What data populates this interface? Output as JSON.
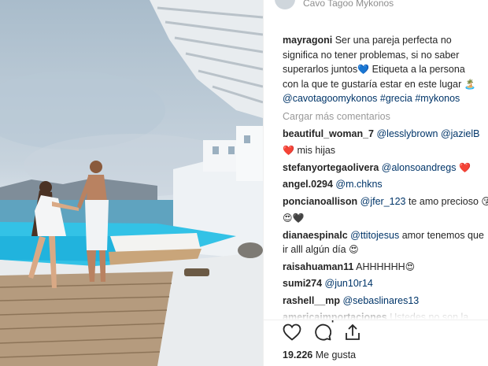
{
  "header": {
    "location": "Cavo Tagoo Mykonos"
  },
  "caption": {
    "user": "mayragoni",
    "text": "Ser una pareja perfecta no significa no tener problemas, si no saber superarlos juntos",
    "emoji1": "💙",
    "text2": " Etiqueta a la persona con la que te gustaría estar en este lugar ",
    "emoji2": "🏝️",
    "tags": "@cavotagoomykonos #grecia #mykonos"
  },
  "load_more": "Cargar más comentarios",
  "comments": [
    {
      "user": "beautiful_woman_7",
      "mentions": "@lesslybrown @jazielB",
      "text": ""
    },
    {
      "user": "",
      "mentions": "",
      "text": "mis hijas",
      "lead_emoji": "❤️"
    },
    {
      "user": "stefanyortegaolivera",
      "mentions": "@alonsoandregs",
      "text": "",
      "trail_emoji": "❤️"
    },
    {
      "user": "angel.0294",
      "mentions": "@m.chkns",
      "text": ""
    },
    {
      "user": "poncianoallison",
      "mentions": "@jfer_123",
      "text": "te amo precioso",
      "trail_emoji": "😘"
    },
    {
      "user": "",
      "mentions": "",
      "text": "",
      "lead_emoji": "😍🖤"
    },
    {
      "user": "dianaespinalc",
      "mentions": "@ttitojesus",
      "text": "amor tenemos que ir alll algún día",
      "trail_emoji": "😍"
    },
    {
      "user": "raisahuaman11",
      "mentions": "",
      "text": "AHHHHHH",
      "trail_emoji": "😍"
    },
    {
      "user": "sumi274",
      "mentions": "@jun10r14",
      "text": ""
    },
    {
      "user": "rashell__mp",
      "mentions": "@sebaslinares13",
      "text": ""
    },
    {
      "user": "americaimportaciones",
      "mentions": "",
      "text": "Ustedes no son la"
    }
  ],
  "actions": {
    "like_icon": "heart-icon",
    "comment_icon": "comment-icon",
    "share_icon": "share-icon"
  },
  "likes": {
    "count": "19.226",
    "label": " Me gusta"
  },
  "colors": {
    "link": "#003569",
    "muted": "#999999",
    "heart": "#ed4956"
  }
}
